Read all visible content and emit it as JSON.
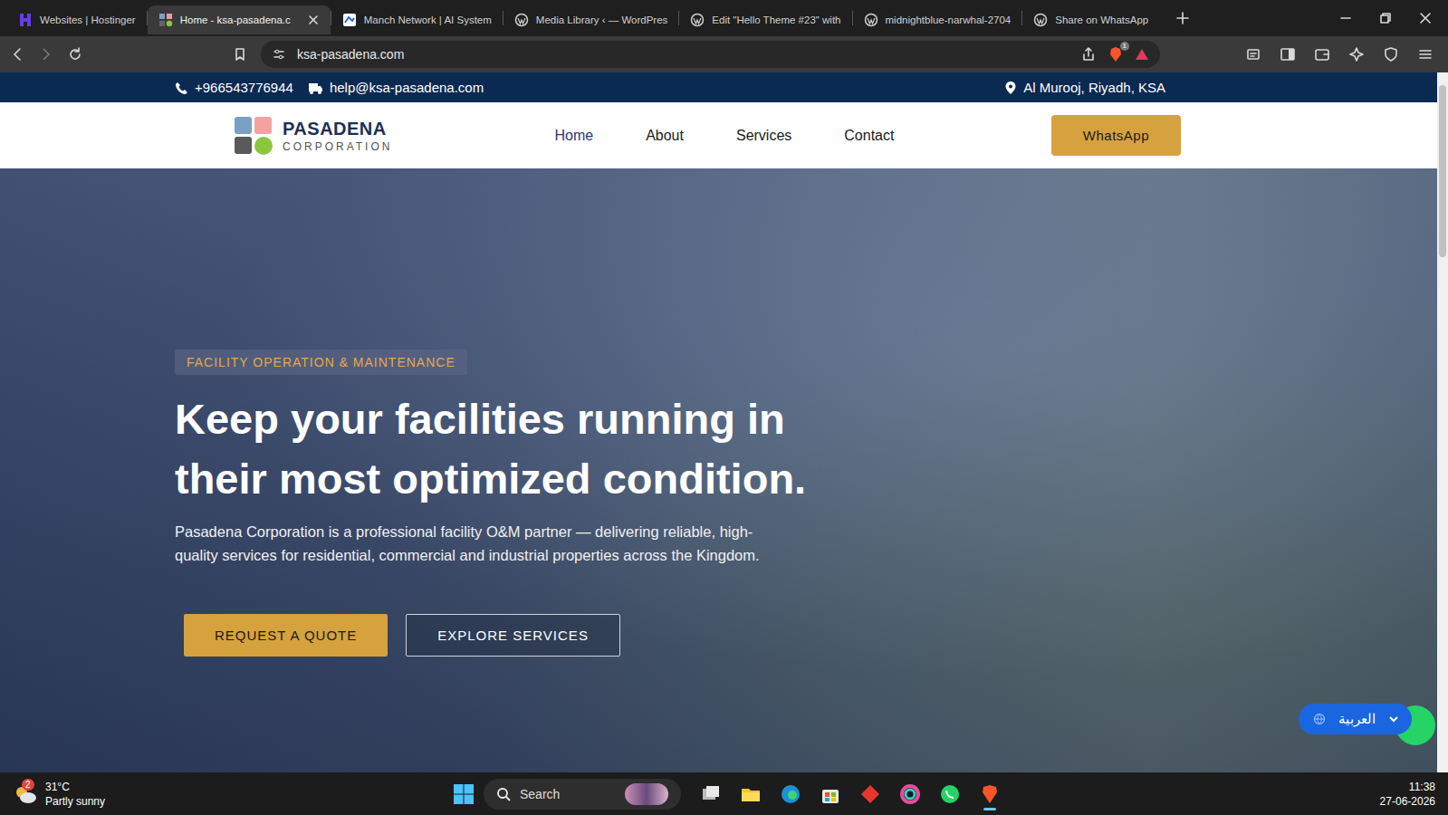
{
  "browser": {
    "tabs": [
      {
        "label": "Websites | Hostinger",
        "selected": false,
        "kind": "hostinger"
      },
      {
        "label": "Home - ksa-pasadena.c",
        "selected": true,
        "kind": "site"
      },
      {
        "label": "Manch Network | AI System",
        "selected": false,
        "kind": "manch"
      },
      {
        "label": "Media Library ‹ — WordPres",
        "selected": false,
        "kind": "wp"
      },
      {
        "label": "Edit \"Hello Theme #23\" with",
        "selected": false,
        "kind": "wp"
      },
      {
        "label": "midnightblue-narwhal-2704",
        "selected": false,
        "kind": "wp"
      },
      {
        "label": "Share on WhatsApp",
        "selected": false,
        "kind": "wp"
      }
    ],
    "address": "ksa-pasadena.com",
    "shields_count": "1"
  },
  "site": {
    "topbar": {
      "phone": "+966543776944",
      "email": "help@ksa-pasadena.com",
      "location": "Al Murooj, Riyadh, KSA"
    },
    "logo": {
      "name": "PASADENA",
      "tagline": "CORPORATION"
    },
    "nav": [
      {
        "label": "Home",
        "selected": true
      },
      {
        "label": "About",
        "selected": false
      },
      {
        "label": "Services",
        "selected": false
      },
      {
        "label": "Contact",
        "selected": false
      }
    ],
    "cta": "WhatsApp",
    "hero": {
      "badge": "FACILITY OPERATION & MAINTENANCE",
      "title": "Keep your facilities running in their most optimized condition.",
      "text": "Pasadena Corporation is a professional facility O&M partner — delivering reliable, high-quality services for residential, commercial and industrial properties across the Kingdom.",
      "buttons": [
        "REQUEST A QUOTE",
        "EXPLORE SERVICES"
      ]
    },
    "language": {
      "label": "العربية"
    }
  },
  "taskbar": {
    "weather": {
      "badge": "2",
      "temp": "31°C",
      "condition": "Partly sunny"
    },
    "search": "Search",
    "time": "11:38",
    "date": "27-06-2026",
    "apps": [
      {
        "kind": "taskview",
        "active": false
      },
      {
        "kind": "explorer",
        "active": false
      },
      {
        "kind": "edge",
        "active": false
      },
      {
        "kind": "store",
        "active": false
      },
      {
        "kind": "red",
        "active": false
      },
      {
        "kind": "photos",
        "active": false
      },
      {
        "kind": "whatsapp",
        "active": false
      },
      {
        "kind": "brave",
        "active": true
      }
    ]
  }
}
